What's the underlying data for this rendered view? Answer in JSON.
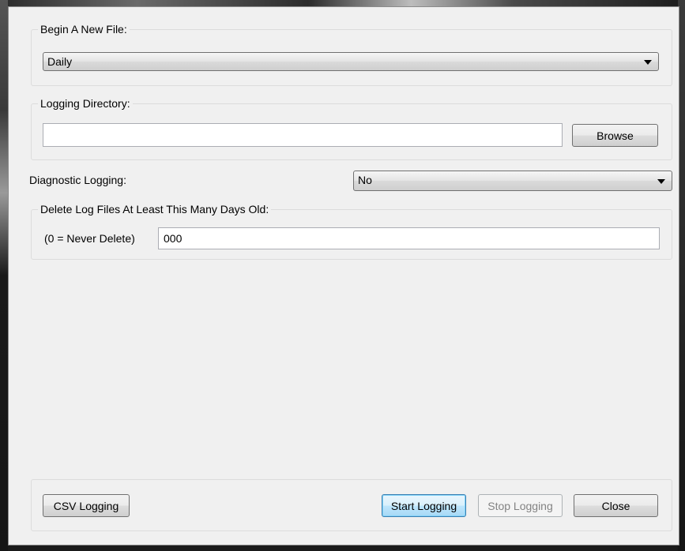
{
  "begin_new_file": {
    "title": "Begin A New File:",
    "selected": "Daily"
  },
  "logging_directory": {
    "title": "Logging Directory:",
    "value": "",
    "browse_label": "Browse"
  },
  "diagnostic_logging": {
    "label": "Diagnostic Logging:",
    "selected": "No"
  },
  "delete_logs": {
    "title": "Delete Log Files At Least This Many Days Old:",
    "hint": "(0 = Never Delete)",
    "value": "000"
  },
  "footer": {
    "csv_label": "CSV Logging",
    "start_label": "Start Logging",
    "stop_label": "Stop Logging",
    "close_label": "Close"
  }
}
